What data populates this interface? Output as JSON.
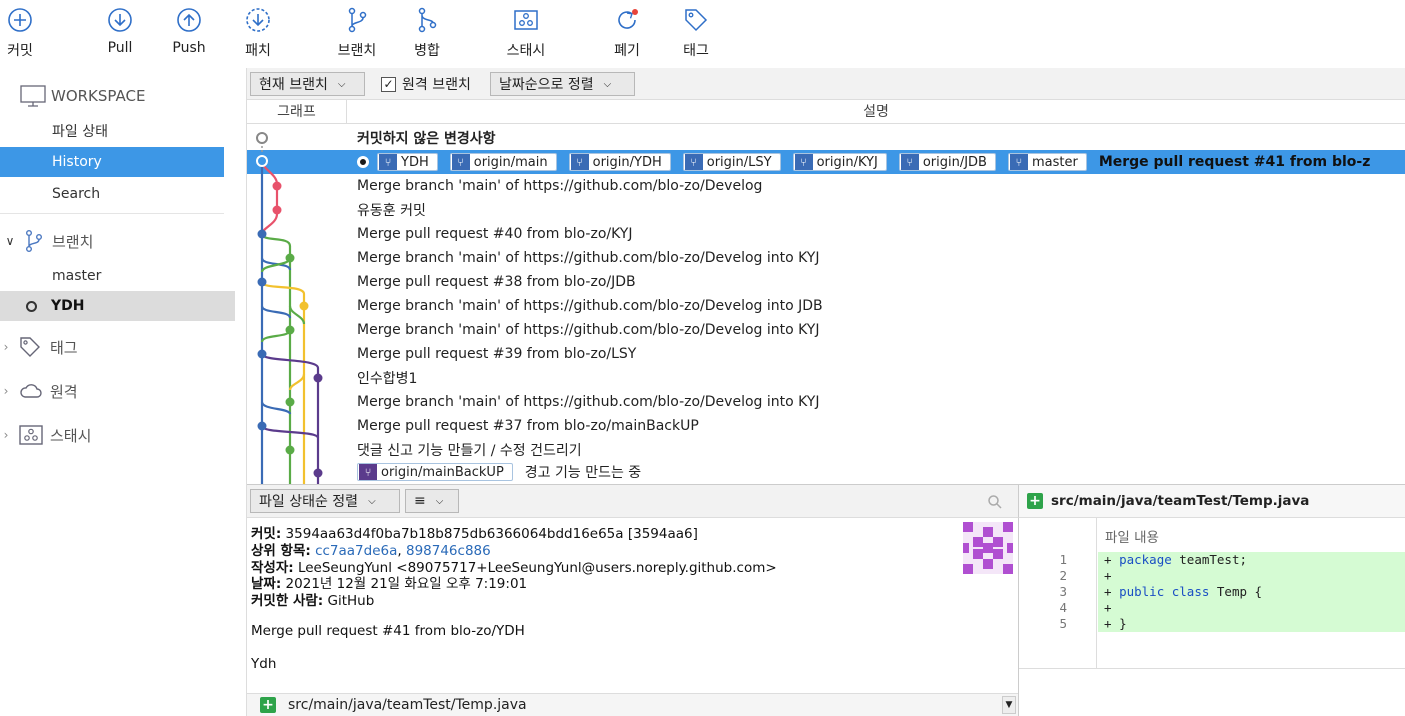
{
  "toolbar": {
    "commit": "커밋",
    "pull": "Pull",
    "push": "Push",
    "patch": "패치",
    "branch": "브랜치",
    "merge": "병합",
    "stash": "스태시",
    "discard": "폐기",
    "tag": "태그"
  },
  "sidebar": {
    "workspace": "WORKSPACE",
    "file_status": "파일 상태",
    "history": "History",
    "search": "Search",
    "branches": "브랜치",
    "branch_master": "master",
    "branch_ydh": "YDH",
    "tags": "태그",
    "remotes": "원격",
    "stashes": "스태시"
  },
  "filter": {
    "branch_scope": "현재 브랜치",
    "remote_branches": "원격 브랜치",
    "remote_checked": true,
    "sort": "날짜순으로 정렬"
  },
  "history": {
    "col_graph": "그래프",
    "col_desc": "설명",
    "uncommitted": "커밋하지 않은 변경사항",
    "selected_refs": [
      "YDH",
      "origin/main",
      "origin/YDH",
      "origin/LSY",
      "origin/KYJ",
      "origin/JDB",
      "master"
    ],
    "selected_message": "Merge pull request #41 from blo-z",
    "rows": [
      "Merge branch 'main' of https://github.com/blo-zo/Develog",
      "유동훈 커밋",
      "Merge pull request #40 from blo-zo/KYJ",
      "Merge branch 'main' of https://github.com/blo-zo/Develog into KYJ",
      "Merge pull request #38 from blo-zo/JDB",
      "Merge branch 'main' of https://github.com/blo-zo/Develog into JDB",
      "Merge branch 'main' of https://github.com/blo-zo/Develog into KYJ",
      "Merge pull request #39 from blo-zo/LSY",
      "인수합병1",
      "Merge branch 'main' of https://github.com/blo-zo/Develog into KYJ",
      "Merge pull request #37 from blo-zo/mainBackUP",
      "댓글 신고 기능 만들기 / 수정 건드리기"
    ],
    "last_ref": "origin/mainBackUP",
    "last_message": "경고 기능 만드는 중"
  },
  "details": {
    "sort_label": "파일 상태순 정렬",
    "list_icon": "≡",
    "commit_label": "커밋:",
    "commit_value": "3594aa63d4f0ba7b18b875db6366064bdd16e65a [3594aa6]",
    "parents_label": "상위 항목:",
    "parent1": "cc7aa7de6a",
    "parent_sep": ",",
    "parent2": "898746c886",
    "author_label": "작성자:",
    "author_value": "LeeSeungYunl <89075717+LeeSeungYunl@users.noreply.github.com>",
    "date_label": "날짜:",
    "date_value": "2021년 12월 21일 화요일 오후 7:19:01",
    "committer_label": "커밋한 사람:",
    "committer_value": "GitHub",
    "message_line1": "Merge pull request #41 from blo-zo/YDH",
    "message_line2": "Ydh",
    "file_path": "src/main/java/teamTest/Temp.java"
  },
  "diff": {
    "file_path": "src/main/java/teamTest/Temp.java",
    "hunk_header": "파일 내용",
    "lines": [
      {
        "num": "1",
        "prefix": "+ ",
        "kw": "package",
        "rest": " teamTest;"
      },
      {
        "num": "2",
        "prefix": "+",
        "kw": "",
        "rest": ""
      },
      {
        "num": "3",
        "prefix": "+ ",
        "kw": "public class",
        "rest": " Temp {"
      },
      {
        "num": "4",
        "prefix": "+",
        "kw": "",
        "rest": ""
      },
      {
        "num": "5",
        "prefix": "+ ",
        "kw": "",
        "rest": "}"
      }
    ]
  },
  "colors": {
    "accent": "#3d97e6",
    "diff_added_bg": "#d5fbd3",
    "ref_icon": "#3a6bb5",
    "graph_blue": "#3a6bb5",
    "graph_red": "#e8526b",
    "graph_green": "#5aab47",
    "graph_yellow": "#f2c12e",
    "graph_purple": "#5b3b8c"
  }
}
